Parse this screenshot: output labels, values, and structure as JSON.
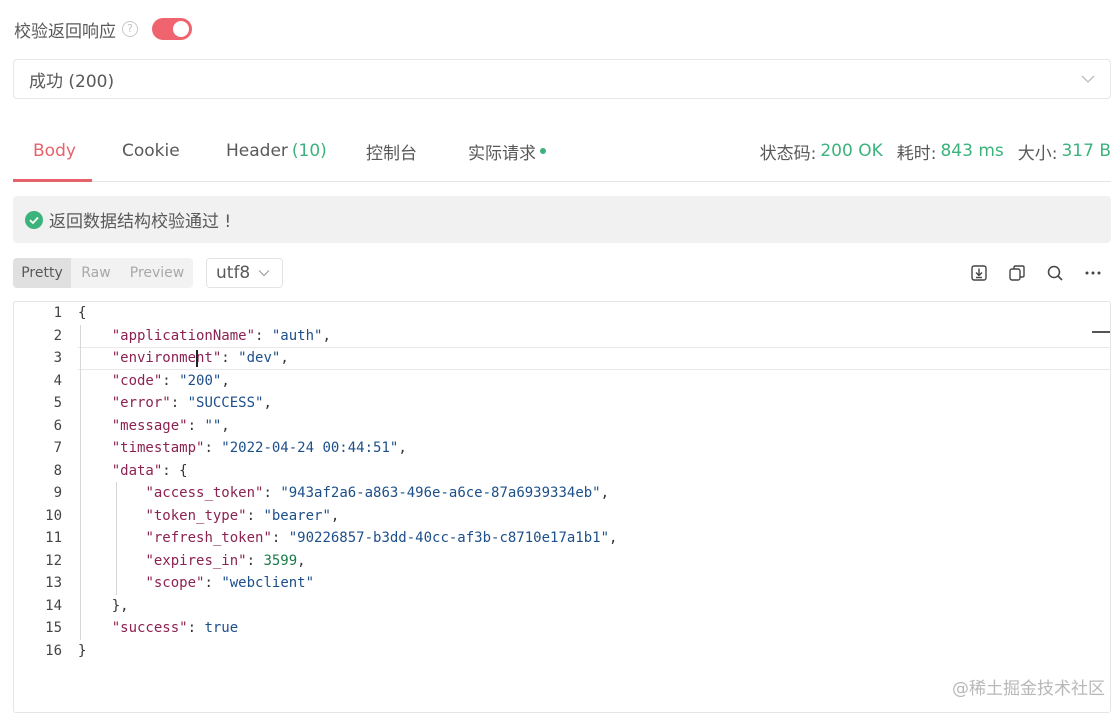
{
  "validation": {
    "label": "校验返回响应",
    "help_glyph": "?",
    "toggle_on": true
  },
  "response_select": {
    "value": "成功 (200)"
  },
  "tabs": [
    {
      "label": "Body",
      "active": true
    },
    {
      "label": "Cookie"
    },
    {
      "label": "Header",
      "count": "(10)"
    },
    {
      "label": "控制台"
    },
    {
      "label": "实际请求",
      "dot": true
    }
  ],
  "stats": {
    "status_label": "状态码:",
    "status_value": "200 OK",
    "time_label": "耗时:",
    "time_value": "843 ms",
    "size_label": "大小:",
    "size_value": "317 B"
  },
  "alert": {
    "text": "返回数据结构校验通过 !"
  },
  "view_modes": [
    "Pretty",
    "Raw",
    "Preview"
  ],
  "encoding": "utf8",
  "toolbar_icons": [
    "download-icon",
    "copy-icon",
    "search-icon",
    "more-icon"
  ],
  "code_lines": [
    [
      [
        "p",
        "{"
      ]
    ],
    [
      [
        "p",
        "    "
      ],
      [
        "k",
        "\"applicationName\""
      ],
      [
        "p",
        ": "
      ],
      [
        "s",
        "\"auth\""
      ],
      [
        "p",
        ","
      ]
    ],
    [
      [
        "p",
        "    "
      ],
      [
        "k",
        "\"environment\""
      ],
      [
        "p",
        ": "
      ],
      [
        "s",
        "\"dev\""
      ],
      [
        "p",
        ","
      ]
    ],
    [
      [
        "p",
        "    "
      ],
      [
        "k",
        "\"code\""
      ],
      [
        "p",
        ": "
      ],
      [
        "s",
        "\"200\""
      ],
      [
        "p",
        ","
      ]
    ],
    [
      [
        "p",
        "    "
      ],
      [
        "k",
        "\"error\""
      ],
      [
        "p",
        ": "
      ],
      [
        "s",
        "\"SUCCESS\""
      ],
      [
        "p",
        ","
      ]
    ],
    [
      [
        "p",
        "    "
      ],
      [
        "k",
        "\"message\""
      ],
      [
        "p",
        ": "
      ],
      [
        "s",
        "\"\""
      ],
      [
        "p",
        ","
      ]
    ],
    [
      [
        "p",
        "    "
      ],
      [
        "k",
        "\"timestamp\""
      ],
      [
        "p",
        ": "
      ],
      [
        "s",
        "\"2022-04-24 00:44:51\""
      ],
      [
        "p",
        ","
      ]
    ],
    [
      [
        "p",
        "    "
      ],
      [
        "k",
        "\"data\""
      ],
      [
        "p",
        ": {"
      ]
    ],
    [
      [
        "p",
        "        "
      ],
      [
        "k",
        "\"access_token\""
      ],
      [
        "p",
        ": "
      ],
      [
        "s",
        "\"943af2a6-a863-496e-a6ce-87a6939334eb\""
      ],
      [
        "p",
        ","
      ]
    ],
    [
      [
        "p",
        "        "
      ],
      [
        "k",
        "\"token_type\""
      ],
      [
        "p",
        ": "
      ],
      [
        "s",
        "\"bearer\""
      ],
      [
        "p",
        ","
      ]
    ],
    [
      [
        "p",
        "        "
      ],
      [
        "k",
        "\"refresh_token\""
      ],
      [
        "p",
        ": "
      ],
      [
        "s",
        "\"90226857-b3dd-40cc-af3b-c8710e17a1b1\""
      ],
      [
        "p",
        ","
      ]
    ],
    [
      [
        "p",
        "        "
      ],
      [
        "k",
        "\"expires_in\""
      ],
      [
        "p",
        ": "
      ],
      [
        "n",
        "3599"
      ],
      [
        "p",
        ","
      ]
    ],
    [
      [
        "p",
        "        "
      ],
      [
        "k",
        "\"scope\""
      ],
      [
        "p",
        ": "
      ],
      [
        "s",
        "\"webclient\""
      ]
    ],
    [
      [
        "p",
        "    },"
      ]
    ],
    [
      [
        "p",
        "    "
      ],
      [
        "k",
        "\"success\""
      ],
      [
        "p",
        ": "
      ],
      [
        "b",
        "true"
      ]
    ],
    [
      [
        "p",
        "}"
      ]
    ]
  ],
  "watermark": "@稀土掘金技术社区"
}
